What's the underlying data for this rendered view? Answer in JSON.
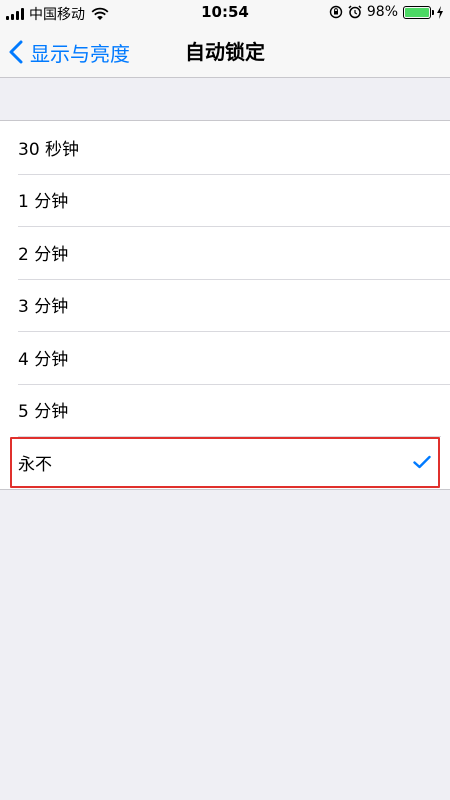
{
  "status_bar": {
    "carrier": "中国移动",
    "time": "10:54",
    "battery_text": "98%",
    "battery_level": 0.98,
    "icons": [
      "signal-icon",
      "wifi-icon",
      "rotation-lock-icon",
      "alarm-icon",
      "battery-icon",
      "charging-icon"
    ]
  },
  "nav": {
    "back_label": "显示与亮度",
    "title": "自动锁定"
  },
  "options": [
    {
      "label": "30 秒钟",
      "selected": false
    },
    {
      "label": "1 分钟",
      "selected": false
    },
    {
      "label": "2 分钟",
      "selected": false
    },
    {
      "label": "3 分钟",
      "selected": false
    },
    {
      "label": "4 分钟",
      "selected": false
    },
    {
      "label": "5 分钟",
      "selected": false
    },
    {
      "label": "永不",
      "selected": true
    }
  ],
  "colors": {
    "accent": "#007aff",
    "highlight_border": "#e0302c",
    "battery": "#4cd964",
    "background": "#efeff4"
  }
}
